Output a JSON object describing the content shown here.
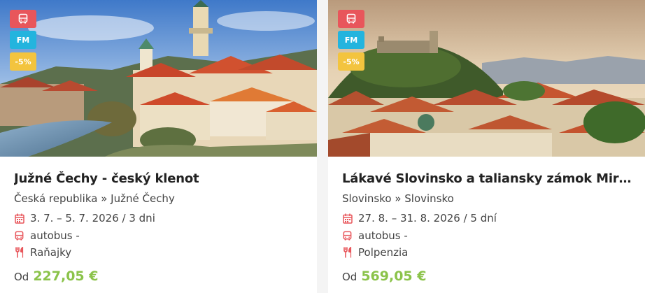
{
  "cards": [
    {
      "badges": {
        "bus": "bus-icon",
        "fm": "FM",
        "discount": "-5%"
      },
      "title": "Južné Čechy - český klenot",
      "location": "Česká republika » Južné Čechy",
      "dates": "3. 7. – 5. 7. 2026 / 3 dni",
      "transport": "autobus -",
      "board": "Raňajky",
      "price_prefix": "Od",
      "price": "227,05 €"
    },
    {
      "badges": {
        "bus": "bus-icon",
        "fm": "FM",
        "discount": "-5%"
      },
      "title": "Lákavé Slovinsko a taliansky zámok Miram...",
      "location": "Slovinsko » Slovinsko",
      "dates": "27. 8. – 31. 8. 2026 / 5 dní",
      "transport": "autobus -",
      "board": "Polpenzia",
      "price_prefix": "Od",
      "price": "569,05 €"
    }
  ],
  "colors": {
    "accent_red": "#e8565b",
    "badge_fm": "#23b4de",
    "badge_discount": "#f3c43e",
    "price_green": "#8bc34a"
  }
}
